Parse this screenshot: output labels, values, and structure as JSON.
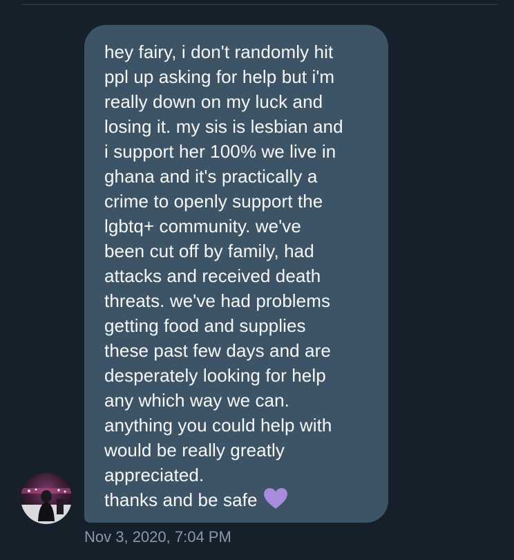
{
  "conversation": {
    "message": {
      "text": "hey fairy, i don't randomly hit\nppl up asking for help but i'm\nreally down on my luck and\nlosing it. my sis is lesbian and\ni support her 100% we live in\nghana and it's practically a\ncrime to openly support the\nlgbtq+ community. we've\nbeen cut off by family, had\nattacks and received death\nthreats. we've had problems\ngetting food and supplies\nthese past few days and are\ndesperately looking for help\nany which way we can.\nanything you could help with\nwould be really greatly\nappreciated.\nthanks and be safe",
      "emoji_icon": "purple-heart-icon",
      "timestamp": "Nov 3, 2020, 7:04 PM"
    }
  },
  "colors": {
    "background": "#15202b",
    "bubble": "#3d5466",
    "text": "#f7f9f9",
    "timestamp": "#8b98a5",
    "heart": "#a78bdc"
  }
}
